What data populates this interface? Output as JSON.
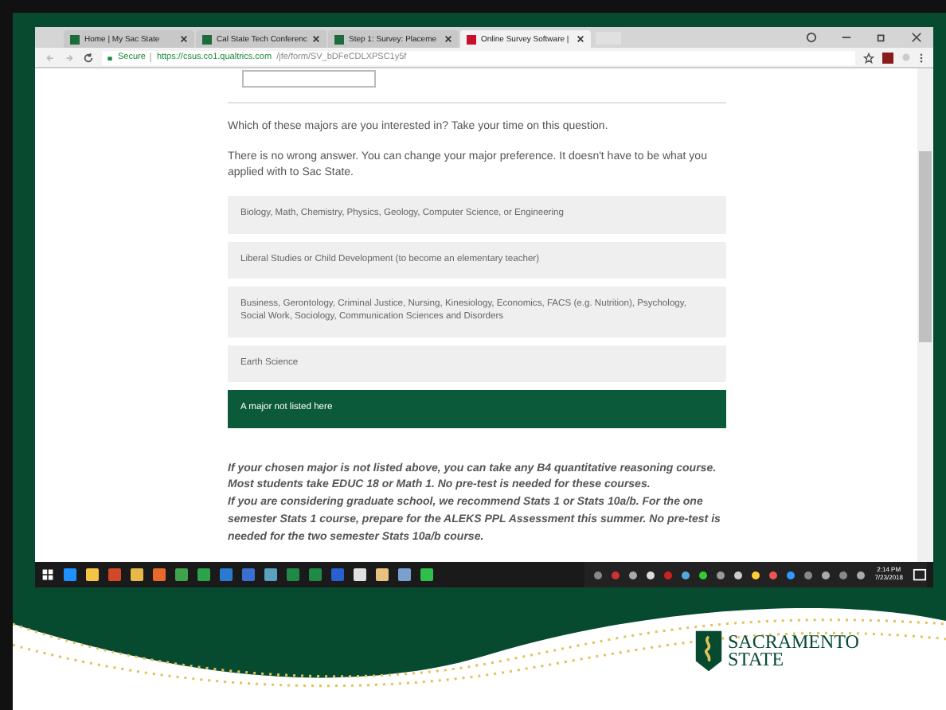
{
  "browser": {
    "tabs": [
      {
        "title": "Home | My Sac State",
        "selected": false
      },
      {
        "title": "Cal State Tech Conferenc",
        "selected": false
      },
      {
        "title": "Step 1: Survey: Placeme",
        "selected": false
      },
      {
        "title": "Online Survey Software |",
        "selected": true
      }
    ],
    "secure_label": "Secure",
    "url_host": "https://csus.co1.qualtrics.com",
    "url_path": "/jfe/form/SV_bDFeCDLXPSC1y5f"
  },
  "survey": {
    "question": "Which of these majors are you interested in? Take your time on this question.",
    "note": "There is no wrong answer.  You can change your major preference.  It doesn't have to be what you applied with to Sac State.",
    "choices": [
      {
        "label": "Biology, Math, Chemistry, Physics, Geology, Computer Science, or Engineering",
        "selected": false
      },
      {
        "label": "Liberal Studies or Child Development (to become an elementary teacher)",
        "selected": false
      },
      {
        "label": "Business, Gerontology, Criminal Justice, Nursing, Kinesiology, Economics, FACS (e.g. Nutrition), Psychology, Social Work, Sociology, Communication Sciences and Disorders",
        "selected": false
      },
      {
        "label": "Earth Science",
        "selected": false
      },
      {
        "label": "A major not listed here",
        "selected": true
      }
    ],
    "info": [
      "If your chosen major is not listed above, you can take any B4 quantitative reasoning course.  Most students take EDUC 18 or Math 1.  No pre-test is needed for these courses.",
      "If you are considering graduate school, we recommend Stats 1 or Stats 10a/b.  For the one semester Stats 1 course, prepare for the ALEKS PPL Assessment this summer.  No pre-test is needed for the two semester Stats 10a/b course."
    ]
  },
  "taskbar": {
    "time": "2:14 PM",
    "date": "7/23/2018"
  },
  "logo": {
    "line1": "SACRAMENTO",
    "line2": "STATE"
  }
}
